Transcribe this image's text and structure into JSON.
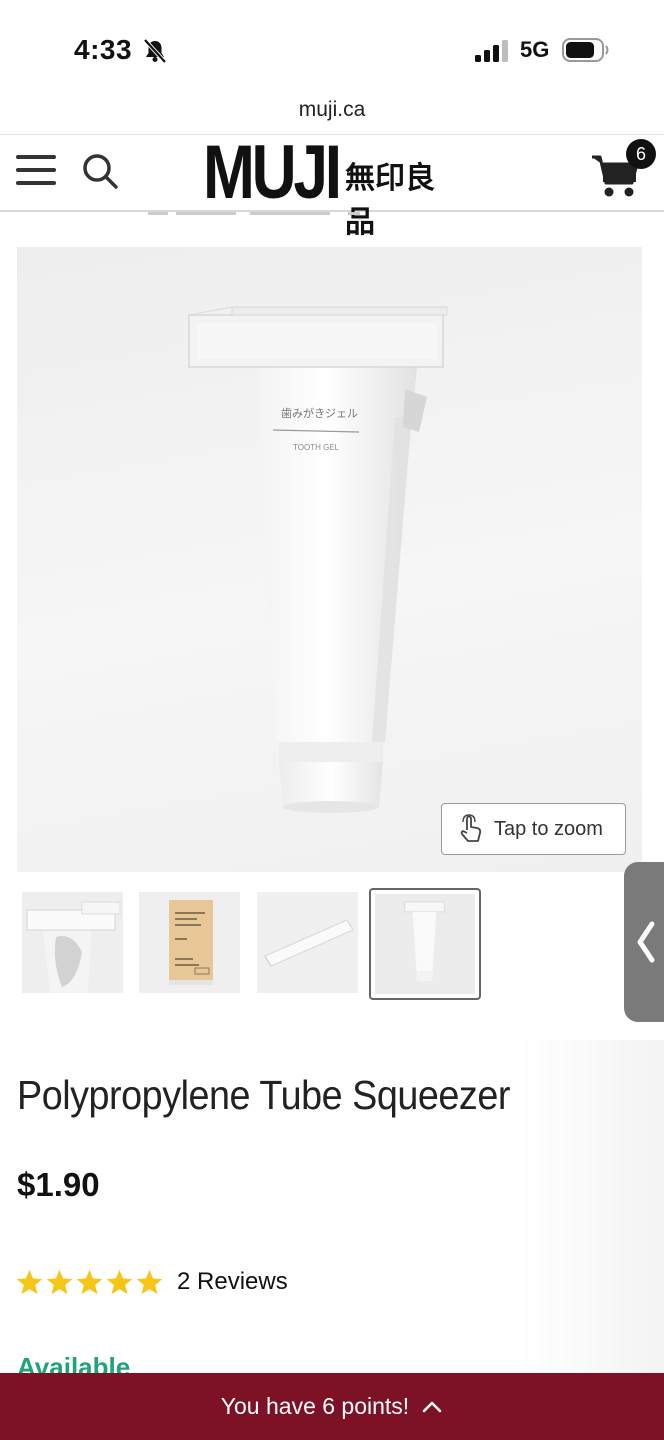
{
  "status_bar": {
    "time": "4:33",
    "network": "5G",
    "icons": [
      "bell-slash-icon",
      "signal-icon",
      "battery-icon"
    ]
  },
  "browser": {
    "url": "muji.ca"
  },
  "header": {
    "logo_text": "MUJI",
    "logo_jp": "無印良品",
    "cart_count": "6",
    "icons": [
      "menu-icon",
      "search-icon",
      "cart-icon"
    ]
  },
  "product": {
    "image_button_label": "Tap to zoom",
    "thumbnails": [
      {
        "name": "thumb-squeezer-on-tube",
        "active": false
      },
      {
        "name": "thumb-package",
        "active": false
      },
      {
        "name": "thumb-squeezer-only",
        "active": false
      },
      {
        "name": "thumb-tooth-gel",
        "active": true
      }
    ],
    "title": "Polypropylene Tube Squeezer",
    "price": "$1.90",
    "rating_stars": 5,
    "reviews_label": "2 Reviews",
    "availability": "Available",
    "tube_print_jp": "歯みがきジェル",
    "tube_print_en": "TOOTH GEL"
  },
  "points_bar": {
    "label": "You have 6 points!"
  },
  "colors": {
    "points_bar_bg": "#7d1226",
    "star": "#f5c518",
    "available": "#1fa37a"
  }
}
